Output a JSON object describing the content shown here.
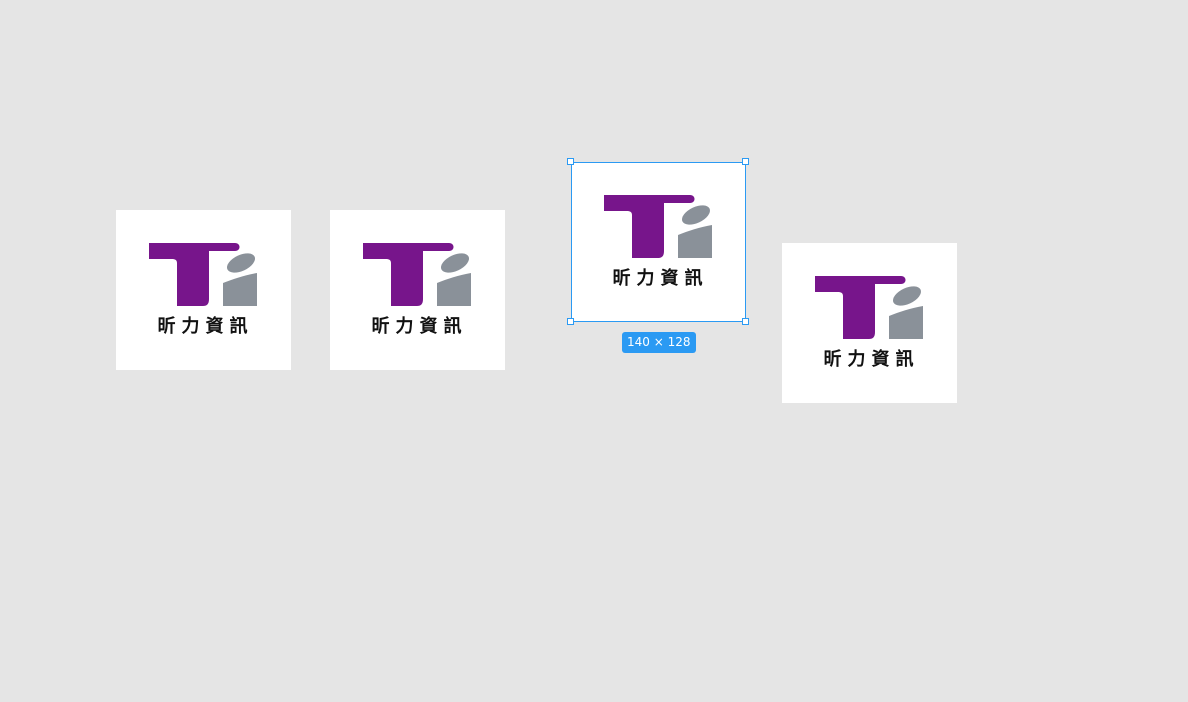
{
  "canvas": {
    "logos": [
      {
        "id": "logo-card-1",
        "text": "昕力資訊"
      },
      {
        "id": "logo-card-2",
        "text": "昕力資訊"
      },
      {
        "id": "logo-card-3",
        "text": "昕力資訊"
      },
      {
        "id": "logo-card-4",
        "text": "昕力資訊"
      }
    ],
    "selection": {
      "size_label": "140 × 128"
    }
  },
  "colors": {
    "canvas_bg": "#e5e5e5",
    "card_bg": "#ffffff",
    "logo_purple": "#77158b",
    "logo_gray": "#8a9199",
    "selection_accent": "#2b9af3"
  }
}
